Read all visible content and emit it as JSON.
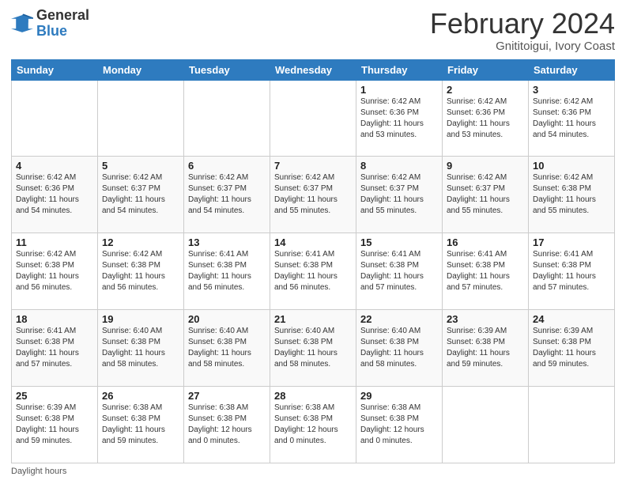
{
  "logo": {
    "general": "General",
    "blue": "Blue"
  },
  "title": {
    "month_year": "February 2024",
    "location": "Gnititoigui, Ivory Coast"
  },
  "days_of_week": [
    "Sunday",
    "Monday",
    "Tuesday",
    "Wednesday",
    "Thursday",
    "Friday",
    "Saturday"
  ],
  "weeks": [
    [
      {
        "day": "",
        "info": ""
      },
      {
        "day": "",
        "info": ""
      },
      {
        "day": "",
        "info": ""
      },
      {
        "day": "",
        "info": ""
      },
      {
        "day": "1",
        "info": "Sunrise: 6:42 AM\nSunset: 6:36 PM\nDaylight: 11 hours and 53 minutes."
      },
      {
        "day": "2",
        "info": "Sunrise: 6:42 AM\nSunset: 6:36 PM\nDaylight: 11 hours and 53 minutes."
      },
      {
        "day": "3",
        "info": "Sunrise: 6:42 AM\nSunset: 6:36 PM\nDaylight: 11 hours and 54 minutes."
      }
    ],
    [
      {
        "day": "4",
        "info": "Sunrise: 6:42 AM\nSunset: 6:36 PM\nDaylight: 11 hours and 54 minutes."
      },
      {
        "day": "5",
        "info": "Sunrise: 6:42 AM\nSunset: 6:37 PM\nDaylight: 11 hours and 54 minutes."
      },
      {
        "day": "6",
        "info": "Sunrise: 6:42 AM\nSunset: 6:37 PM\nDaylight: 11 hours and 54 minutes."
      },
      {
        "day": "7",
        "info": "Sunrise: 6:42 AM\nSunset: 6:37 PM\nDaylight: 11 hours and 55 minutes."
      },
      {
        "day": "8",
        "info": "Sunrise: 6:42 AM\nSunset: 6:37 PM\nDaylight: 11 hours and 55 minutes."
      },
      {
        "day": "9",
        "info": "Sunrise: 6:42 AM\nSunset: 6:37 PM\nDaylight: 11 hours and 55 minutes."
      },
      {
        "day": "10",
        "info": "Sunrise: 6:42 AM\nSunset: 6:38 PM\nDaylight: 11 hours and 55 minutes."
      }
    ],
    [
      {
        "day": "11",
        "info": "Sunrise: 6:42 AM\nSunset: 6:38 PM\nDaylight: 11 hours and 56 minutes."
      },
      {
        "day": "12",
        "info": "Sunrise: 6:42 AM\nSunset: 6:38 PM\nDaylight: 11 hours and 56 minutes."
      },
      {
        "day": "13",
        "info": "Sunrise: 6:41 AM\nSunset: 6:38 PM\nDaylight: 11 hours and 56 minutes."
      },
      {
        "day": "14",
        "info": "Sunrise: 6:41 AM\nSunset: 6:38 PM\nDaylight: 11 hours and 56 minutes."
      },
      {
        "day": "15",
        "info": "Sunrise: 6:41 AM\nSunset: 6:38 PM\nDaylight: 11 hours and 57 minutes."
      },
      {
        "day": "16",
        "info": "Sunrise: 6:41 AM\nSunset: 6:38 PM\nDaylight: 11 hours and 57 minutes."
      },
      {
        "day": "17",
        "info": "Sunrise: 6:41 AM\nSunset: 6:38 PM\nDaylight: 11 hours and 57 minutes."
      }
    ],
    [
      {
        "day": "18",
        "info": "Sunrise: 6:41 AM\nSunset: 6:38 PM\nDaylight: 11 hours and 57 minutes."
      },
      {
        "day": "19",
        "info": "Sunrise: 6:40 AM\nSunset: 6:38 PM\nDaylight: 11 hours and 58 minutes."
      },
      {
        "day": "20",
        "info": "Sunrise: 6:40 AM\nSunset: 6:38 PM\nDaylight: 11 hours and 58 minutes."
      },
      {
        "day": "21",
        "info": "Sunrise: 6:40 AM\nSunset: 6:38 PM\nDaylight: 11 hours and 58 minutes."
      },
      {
        "day": "22",
        "info": "Sunrise: 6:40 AM\nSunset: 6:38 PM\nDaylight: 11 hours and 58 minutes."
      },
      {
        "day": "23",
        "info": "Sunrise: 6:39 AM\nSunset: 6:38 PM\nDaylight: 11 hours and 59 minutes."
      },
      {
        "day": "24",
        "info": "Sunrise: 6:39 AM\nSunset: 6:38 PM\nDaylight: 11 hours and 59 minutes."
      }
    ],
    [
      {
        "day": "25",
        "info": "Sunrise: 6:39 AM\nSunset: 6:38 PM\nDaylight: 11 hours and 59 minutes."
      },
      {
        "day": "26",
        "info": "Sunrise: 6:38 AM\nSunset: 6:38 PM\nDaylight: 11 hours and 59 minutes."
      },
      {
        "day": "27",
        "info": "Sunrise: 6:38 AM\nSunset: 6:38 PM\nDaylight: 12 hours and 0 minutes."
      },
      {
        "day": "28",
        "info": "Sunrise: 6:38 AM\nSunset: 6:38 PM\nDaylight: 12 hours and 0 minutes."
      },
      {
        "day": "29",
        "info": "Sunrise: 6:38 AM\nSunset: 6:38 PM\nDaylight: 12 hours and 0 minutes."
      },
      {
        "day": "",
        "info": ""
      },
      {
        "day": "",
        "info": ""
      }
    ]
  ],
  "footer": {
    "daylight_label": "Daylight hours"
  }
}
